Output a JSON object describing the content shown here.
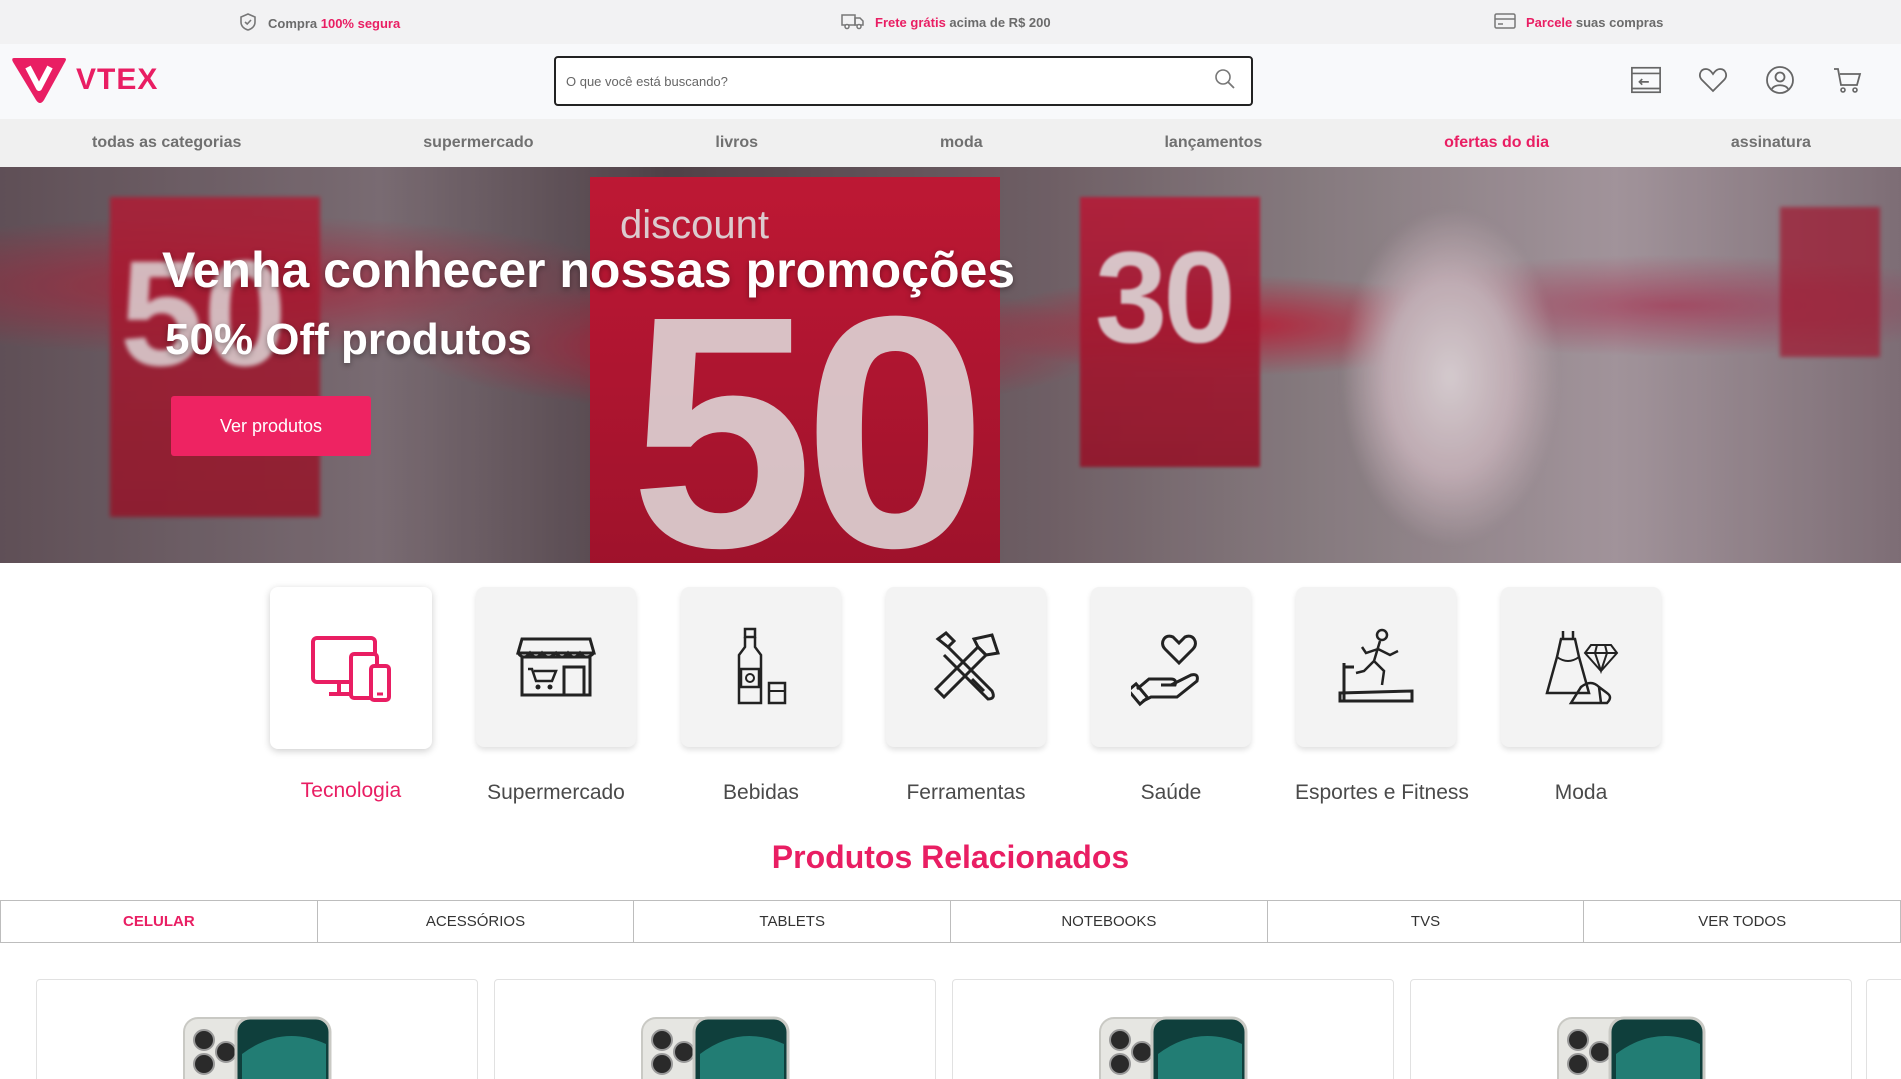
{
  "topbar": {
    "secure_prefix": "Compra ",
    "secure_highlight": "100% segura",
    "shipping_highlight": "Frete grátis",
    "shipping_suffix": " acima de R$ 200",
    "installment_highlight": "Parcele",
    "installment_suffix": " suas compras"
  },
  "header": {
    "logo_text": "VTEX",
    "search_placeholder": "O que você está buscando?"
  },
  "nav": {
    "items": [
      "todas as categorias",
      "supermercado",
      "livros",
      "moda",
      "lançamentos",
      "ofertas do dia",
      "assinatura"
    ]
  },
  "hero": {
    "title": "Venha conhecer nossas promoções",
    "subtitle": "50% Off produtos",
    "cta": "Ver produtos",
    "bg_text_discount": "discount",
    "bg_text_50": "50",
    "bg_text_30": "30",
    "bg_text_50_small": "50"
  },
  "categories": [
    {
      "label": "Tecnologia",
      "icon": "devices-icon",
      "active": true
    },
    {
      "label": "Supermercado",
      "icon": "store-icon"
    },
    {
      "label": "Bebidas",
      "icon": "bottle-icon"
    },
    {
      "label": "Ferramentas",
      "icon": "tools-icon"
    },
    {
      "label": "Saúde",
      "icon": "health-icon"
    },
    {
      "label": "Esportes e Fitness",
      "icon": "treadmill-icon"
    },
    {
      "label": "Moda",
      "icon": "dress-icon"
    }
  ],
  "related": {
    "title": "Produtos Relacionados",
    "tabs": [
      "CELULAR",
      "ACESSÓRIOS",
      "TABLETS",
      "NOTEBOOKS",
      "TVS",
      "VER TODOS"
    ]
  },
  "colors": {
    "brand": "#e91e63",
    "cta": "#ee2362"
  }
}
